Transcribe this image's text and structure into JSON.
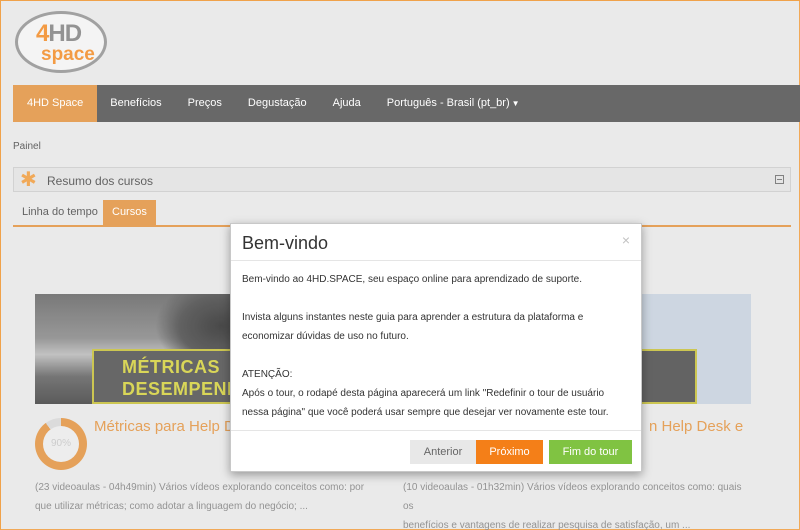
{
  "brand": {
    "logo_text_top": "HD",
    "logo_text_four": "4",
    "logo_text_bottom": "space"
  },
  "nav": {
    "items": [
      {
        "label": "4HD Space"
      },
      {
        "label": "Benefícios"
      },
      {
        "label": "Preços"
      },
      {
        "label": "Degustação"
      },
      {
        "label": "Ajuda"
      },
      {
        "label": "Português - Brasil (pt_br)"
      }
    ]
  },
  "breadcrumb": "Painel",
  "block": {
    "title": "Resumo dos cursos"
  },
  "tabs": [
    {
      "label": "Linha do tempo"
    },
    {
      "label": "Cursos"
    }
  ],
  "courses": [
    {
      "banner_line1": "MÉTRICAS",
      "banner_line2": "DESEMPENHO",
      "progress": "90%",
      "title": "Métricas para Help D",
      "desc_line1": "(23 videoaulas - 04h49min)  Vários vídeos explorando conceitos como: por",
      "desc_line2": "que utilizar métricas; como adotar a linguagem do negócio; ..."
    },
    {
      "title": "n Help Desk e",
      "desc_line1": "(10 videoaulas - 01h32min)  Vários vídeos explorando conceitos como: quais os",
      "desc_line2": "benefícios e vantagens de realizar pesquisa de satisfação, um ..."
    }
  ],
  "modal": {
    "title": "Bem-vindo",
    "close": "×",
    "p1": "Bem-vindo ao 4HD.SPACE, seu espaço online para aprendizado de suporte.",
    "p2a": "Invista alguns instantes neste guia para aprender a estrutura da plataforma e",
    "p2b": "economizar dúvidas de uso no futuro.",
    "p3a": "ATENÇÃO:",
    "p3b": "Após o tour, o rodapé desta página aparecerá um link \"Redefinir o tour de usuário",
    "p3c": "nessa página\" que você poderá usar sempre que desejar ver novamente este tour.",
    "btn_prev": "Anterior",
    "btn_next": "Próximo",
    "btn_end": "Fim do tour"
  },
  "colors": {
    "accent": "#e39a4c",
    "nav_bg": "#5c5c5c",
    "next": "#f47f18",
    "end": "#80c342"
  }
}
